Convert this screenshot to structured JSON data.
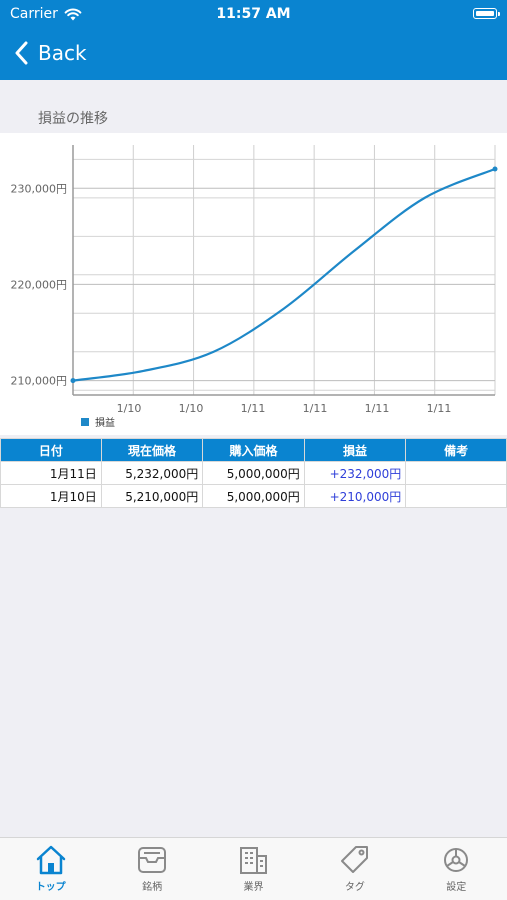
{
  "status_bar": {
    "carrier": "Carrier",
    "time": "11:57 AM"
  },
  "nav": {
    "back_label": "Back"
  },
  "section": {
    "title": "損益の推移"
  },
  "chart_data": {
    "type": "line",
    "x": [
      "1/10",
      "1/10",
      "1/10",
      "1/11",
      "1/11",
      "1/11",
      "1/11"
    ],
    "values": [
      210000,
      211000,
      213000,
      217500,
      223500,
      229000,
      232000
    ],
    "y_ticks": [
      "210,000円",
      "220,000円",
      "230,000円"
    ],
    "y_tick_values": [
      210000,
      220000,
      230000
    ],
    "x_tick_labels": [
      "1/10",
      "1/10",
      "1/11",
      "1/11",
      "1/11",
      "1/11"
    ],
    "ylim": [
      208500,
      234500
    ],
    "series": [
      {
        "name": "損益",
        "color": "#1e88c8"
      }
    ],
    "grid": true,
    "legend": "bottom-left"
  },
  "table": {
    "headers": [
      "日付",
      "現在価格",
      "購入価格",
      "損益",
      "備考"
    ],
    "rows": [
      [
        "1月11日",
        "5,232,000円",
        "5,000,000円",
        "+232,000円",
        ""
      ],
      [
        "1月10日",
        "5,210,000円",
        "5,000,000円",
        "+210,000円",
        ""
      ]
    ]
  },
  "tabbar": {
    "items": [
      {
        "label": "トップ",
        "icon": "home-icon",
        "active": true
      },
      {
        "label": "銘柄",
        "icon": "inbox-icon",
        "active": false
      },
      {
        "label": "業界",
        "icon": "building-icon",
        "active": false
      },
      {
        "label": "タグ",
        "icon": "tag-icon",
        "active": false
      },
      {
        "label": "設定",
        "icon": "gear-icon",
        "active": false
      }
    ]
  },
  "colors": {
    "primary": "#0a84d0",
    "line": "#1e88c8",
    "positive": "#2f3fd9"
  }
}
